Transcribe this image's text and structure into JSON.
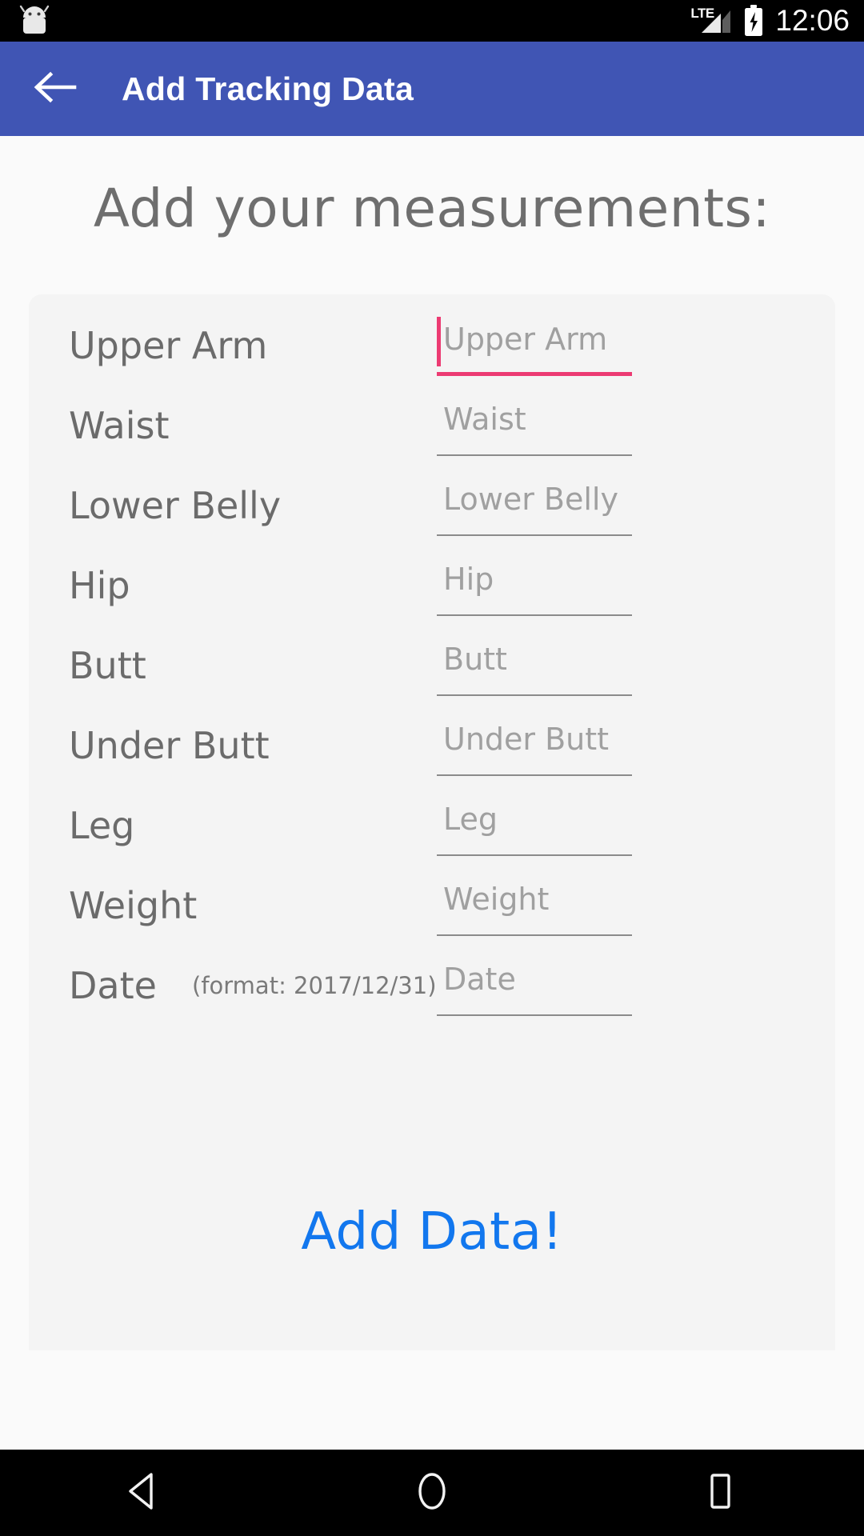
{
  "statusbar": {
    "network_label": "LTE",
    "clock": "12:06",
    "icons": {
      "android": "android-logo-icon",
      "signal": "signal-bars-icon",
      "battery": "battery-charging-icon"
    }
  },
  "appbar": {
    "title": "Add Tracking Data",
    "back_icon": "back-arrow-icon",
    "color": "#4055b4"
  },
  "main": {
    "heading": "Add your measurements:",
    "submit_label": "Add Data!",
    "submit_color": "#1277ee",
    "focus_color": "#ec3b72",
    "rows": [
      {
        "label": "Upper Arm",
        "placeholder": "Upper Arm",
        "value": "",
        "hint": "",
        "focused": true
      },
      {
        "label": "Waist",
        "placeholder": "Waist",
        "value": "",
        "hint": "",
        "focused": false
      },
      {
        "label": "Lower Belly",
        "placeholder": "Lower Belly",
        "value": "",
        "hint": "",
        "focused": false
      },
      {
        "label": "Hip",
        "placeholder": "Hip",
        "value": "",
        "hint": "",
        "focused": false
      },
      {
        "label": "Butt",
        "placeholder": "Butt",
        "value": "",
        "hint": "",
        "focused": false
      },
      {
        "label": "Under Butt",
        "placeholder": "Under Butt",
        "value": "",
        "hint": "",
        "focused": false
      },
      {
        "label": "Leg",
        "placeholder": "Leg",
        "value": "",
        "hint": "",
        "focused": false
      },
      {
        "label": "Weight",
        "placeholder": "Weight",
        "value": "",
        "hint": "",
        "focused": false
      },
      {
        "label": "Date",
        "placeholder": "Date",
        "value": "",
        "hint": "(format: 2017/12/31)",
        "focused": false
      }
    ]
  },
  "navbar": {
    "back_icon": "nav-back-triangle-icon",
    "home_icon": "nav-home-circle-icon",
    "recents_icon": "nav-recents-square-icon"
  }
}
